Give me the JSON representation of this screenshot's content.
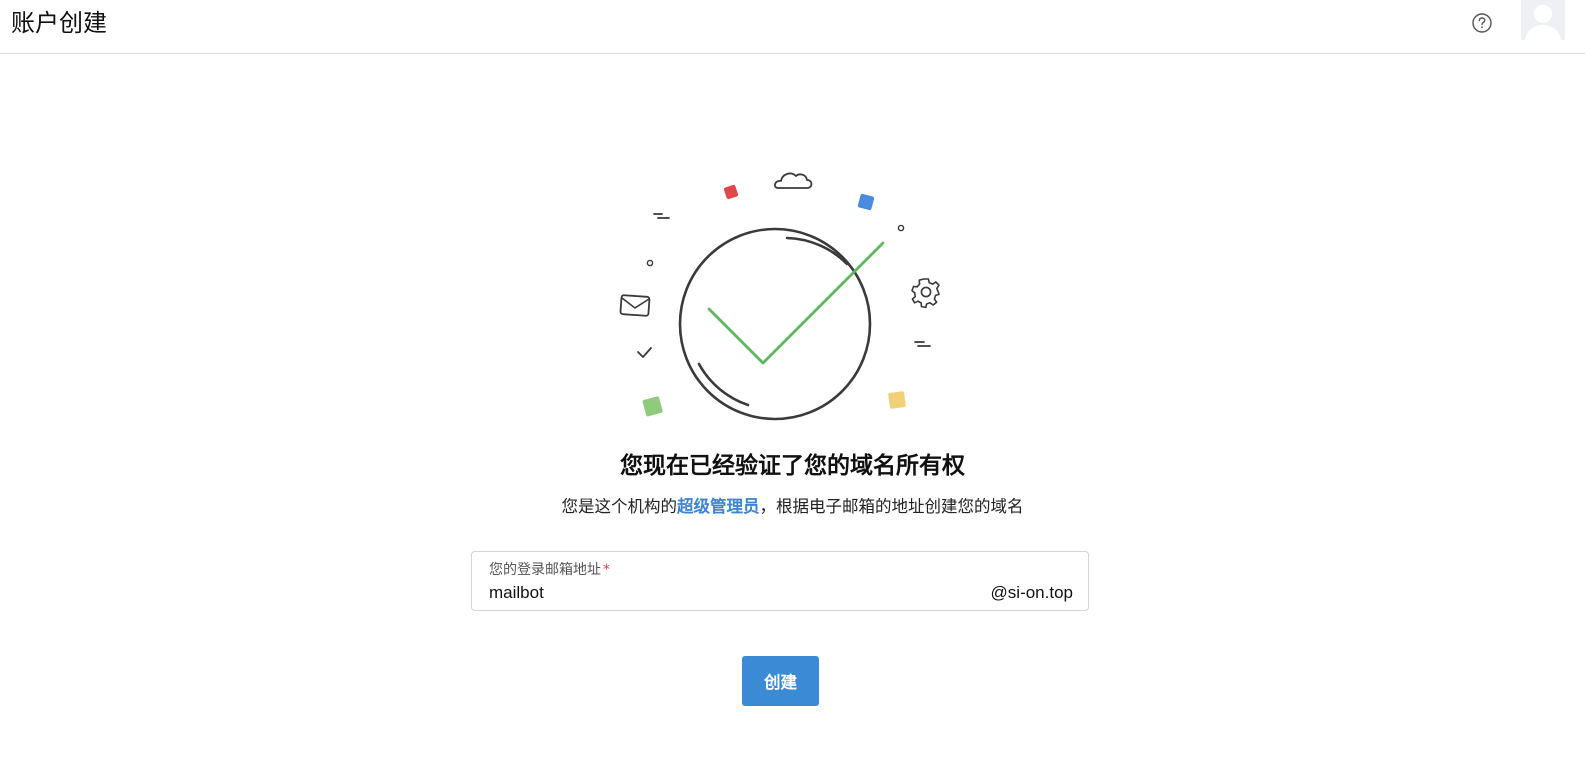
{
  "header": {
    "title": "账户创建",
    "help_icon": "help-circle-icon",
    "avatar_icon": "user-avatar-icon"
  },
  "hero": {
    "headline": "您现在已经验证了您的域名所有权",
    "sub_before": "您是这个机构的",
    "sub_highlight": "超级管理员",
    "sub_after": "，根据电子邮箱的地址创建您的域名"
  },
  "form": {
    "email_label": "您的登录邮箱地址",
    "required_mark": "*",
    "email_value": "mailbot",
    "domain_suffix": "@si-on.top"
  },
  "actions": {
    "create_label": "创建"
  },
  "colors": {
    "accent": "#3b8ad6",
    "highlight_text": "#3b84d1",
    "check_green": "#5cb85c",
    "required_red": "#e04040",
    "deco_red": "#e0474c",
    "deco_blue": "#4a8be0",
    "deco_green": "#8fca7d",
    "deco_yellow": "#f2d078"
  }
}
